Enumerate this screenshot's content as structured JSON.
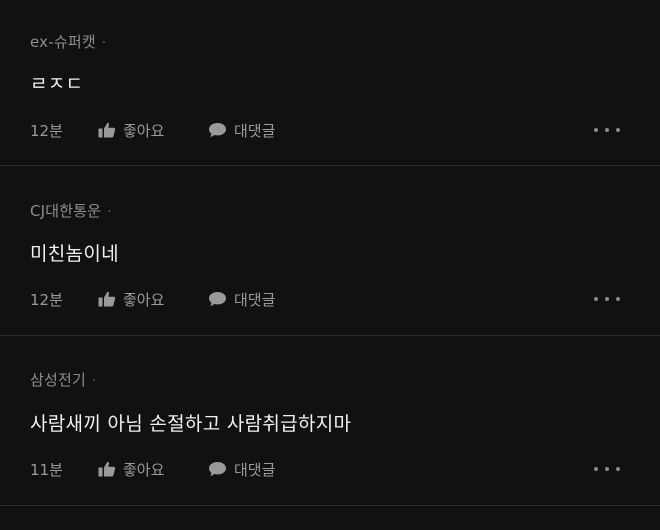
{
  "comments": [
    {
      "author": "ex-슈퍼캣",
      "dot": "·",
      "body": "ㄹㅈㄷ",
      "time": "12분",
      "like_label": "좋아요",
      "reply_label": "대댓글"
    },
    {
      "author": "CJ대한통운",
      "dot": "·",
      "body": "미친놈이네",
      "time": "12분",
      "like_label": "좋아요",
      "reply_label": "대댓글"
    },
    {
      "author": "삼성전기",
      "dot": "·",
      "body": "사람새끼 아님 손절하고 사람취급하지마",
      "time": "11분",
      "like_label": "좋아요",
      "reply_label": "대댓글"
    }
  ],
  "icons": {
    "like": "thumbs-up-icon",
    "reply": "speech-bubble-icon",
    "more": "more-dots-icon"
  },
  "colors": {
    "background": "#111112",
    "divider": "#2b2b2d",
    "author": "#8d8d90",
    "body": "#f0f0f0",
    "meta": "#9a9a9d"
  }
}
